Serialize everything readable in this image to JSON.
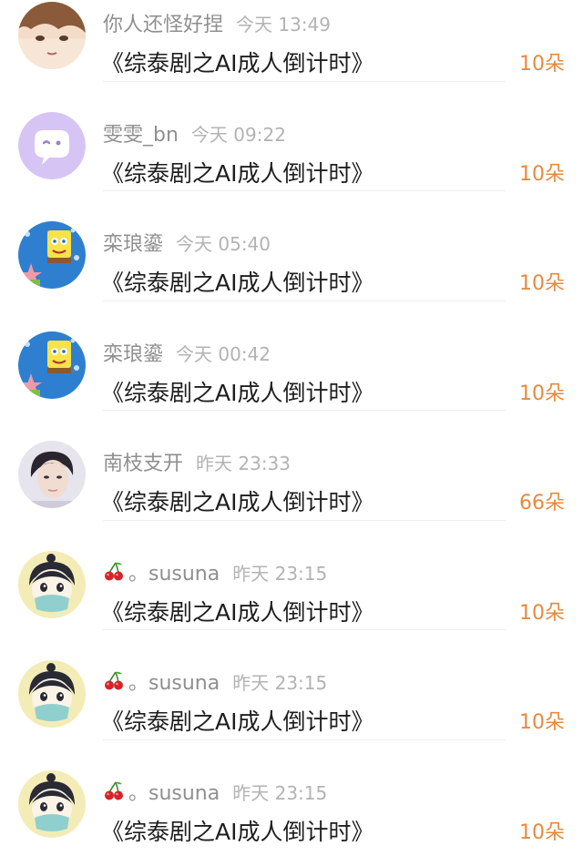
{
  "rows": [
    {
      "name": "你人还怪好捏",
      "time": "今天 13:49",
      "title": "《综泰剧之AI成人倒计时》",
      "count": "10朵",
      "avatar": "anime-boy-avatar"
    },
    {
      "name": "雯雯_bn",
      "time": "今天 09:22",
      "title": "《综泰剧之AI成人倒计时》",
      "count": "10朵",
      "avatar": "purple-wink-avatar"
    },
    {
      "name": "栾琅鎏",
      "time": "今天 05:40",
      "title": "《综泰剧之AI成人倒计时》",
      "count": "10朵",
      "avatar": "spongebob-avatar"
    },
    {
      "name": "栾琅鎏",
      "time": "今天 00:42",
      "title": "《综泰剧之AI成人倒计时》",
      "count": "10朵",
      "avatar": "spongebob-avatar"
    },
    {
      "name": "南枝支开",
      "time": "昨天 23:33",
      "title": "《综泰剧之AI成人倒计时》",
      "count": "66朵",
      "avatar": "portrait-avatar"
    },
    {
      "name": "。susuna",
      "time": "昨天 23:15",
      "title": "《综泰剧之AI成人倒计时》",
      "count": "10朵",
      "avatar": "cartoon-masked-avatar",
      "name_icon": "cherry-icon"
    },
    {
      "name": "。susuna",
      "time": "昨天 23:15",
      "title": "《综泰剧之AI成人倒计时》",
      "count": "10朵",
      "avatar": "cartoon-masked-avatar",
      "name_icon": "cherry-icon"
    },
    {
      "name": "。susuna",
      "time": "昨天 23:15",
      "title": "《综泰剧之AI成人倒计时》",
      "count": "10朵",
      "avatar": "cartoon-masked-avatar",
      "name_icon": "cherry-icon"
    }
  ],
  "colors": {
    "name": "#8f8f8f",
    "time": "#b3b3b3",
    "title": "#1e1e1e",
    "count": "#e68a3e",
    "divider": "#eeeeee"
  }
}
